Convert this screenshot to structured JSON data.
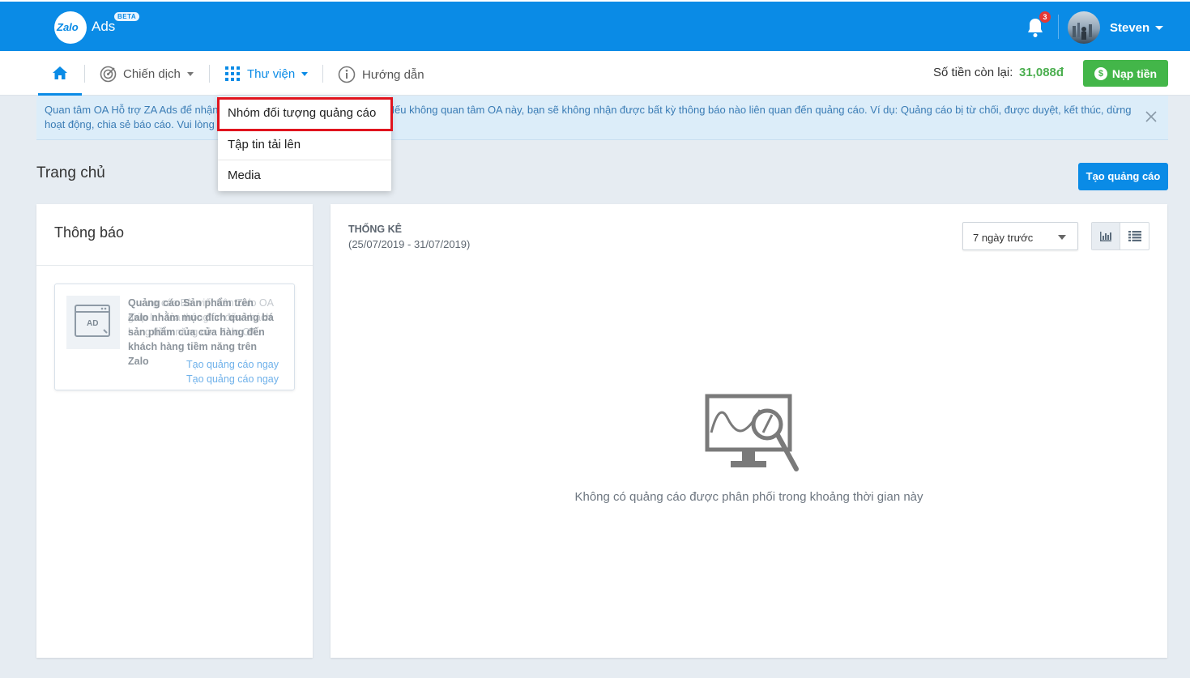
{
  "header": {
    "logo_text": "Zalo",
    "product": "Ads",
    "beta_label": "BETA",
    "notification_count": "3",
    "username": "Steven"
  },
  "nav": {
    "items": [
      {
        "label": "Chiến dịch"
      },
      {
        "label": "Thư viện"
      },
      {
        "label": "Hướng dẫn"
      }
    ],
    "balance_label": "Số tiền còn lại:",
    "balance_value": "31,088đ",
    "topup_label": "Nạp tiền"
  },
  "banner": {
    "text": "Quan tâm OA Hỗ trợ ZA Ads để nhận thông báo quan trọng về tài khoản. Nếu không quan tâm OA này, bạn sẽ không nhận được bất kỳ thông báo nào liên quan đến quảng cáo. Ví dụ: Quảng cáo bị từ chối, được duyệt, kết thúc, dừng hoạt động, chia sẻ báo cáo. Vui lòng quan tâm OA."
  },
  "dropdown": {
    "items": [
      {
        "label": "Nhóm đối tượng quảng cáo"
      },
      {
        "label": "Tập tin tải lên"
      },
      {
        "label": "Media"
      }
    ]
  },
  "page": {
    "title": "Trang chủ",
    "create_button": "Tạo quảng cáo"
  },
  "notifications": {
    "title": "Thông báo",
    "ad_icon_label": "AD",
    "card_text_back": "Quảng cáo Bài viết trên Zalo OA giúp lan tỏa thông tin đến khách hàng tiềm năng của Zalo OA.",
    "card_text_front": "Quảng cáo Sản phẩm trên Zalo nhằm mục đích quảng bá sản phẩm của cửa hàng đến khách hàng tiềm năng trên Zalo",
    "card_link_1": "Tạo quảng cáo ngay",
    "card_link_2": "Tạo quảng cáo ngay"
  },
  "stats": {
    "title": "THỐNG KÊ",
    "range": "(25/07/2019 - 31/07/2019)",
    "period_value": "7 ngày trước",
    "empty_message": "Không có quảng cáo được phân phối trong khoảng thời gian này"
  },
  "colors": {
    "brand_blue": "#0a8be6",
    "balance_green": "#4caf50",
    "topup_green": "#43b649",
    "highlight_red": "#e0141e"
  }
}
